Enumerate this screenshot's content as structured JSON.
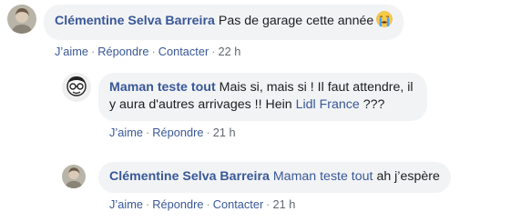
{
  "comments": [
    {
      "author": "Clémentine Selva Barreira",
      "text": "Pas de garage cette année",
      "emoji": "crying-face-icon",
      "actions": {
        "like": "J’aime",
        "reply": "Répondre",
        "contact": "Contacter",
        "time": "22 h"
      }
    },
    {
      "author": "Maman teste tout",
      "text_before": "Mais si, mais si ! Il faut attendre, il y aura d'autres arrivages !! Hein",
      "mention": "Lidl France",
      "text_after": "???",
      "actions": {
        "like": "J’aime",
        "reply": "Répondre",
        "time": "21 h"
      }
    },
    {
      "author": "Clémentine Selva Barreira",
      "mention": "Maman teste tout",
      "text": "ah j’espère",
      "actions": {
        "like": "J’aime",
        "reply": "Répondre",
        "contact": "Contacter",
        "time": "21 h"
      }
    }
  ],
  "separator": "·",
  "colors": {
    "link": "#385898",
    "bubble": "#f2f3f5",
    "meta": "#606770"
  }
}
